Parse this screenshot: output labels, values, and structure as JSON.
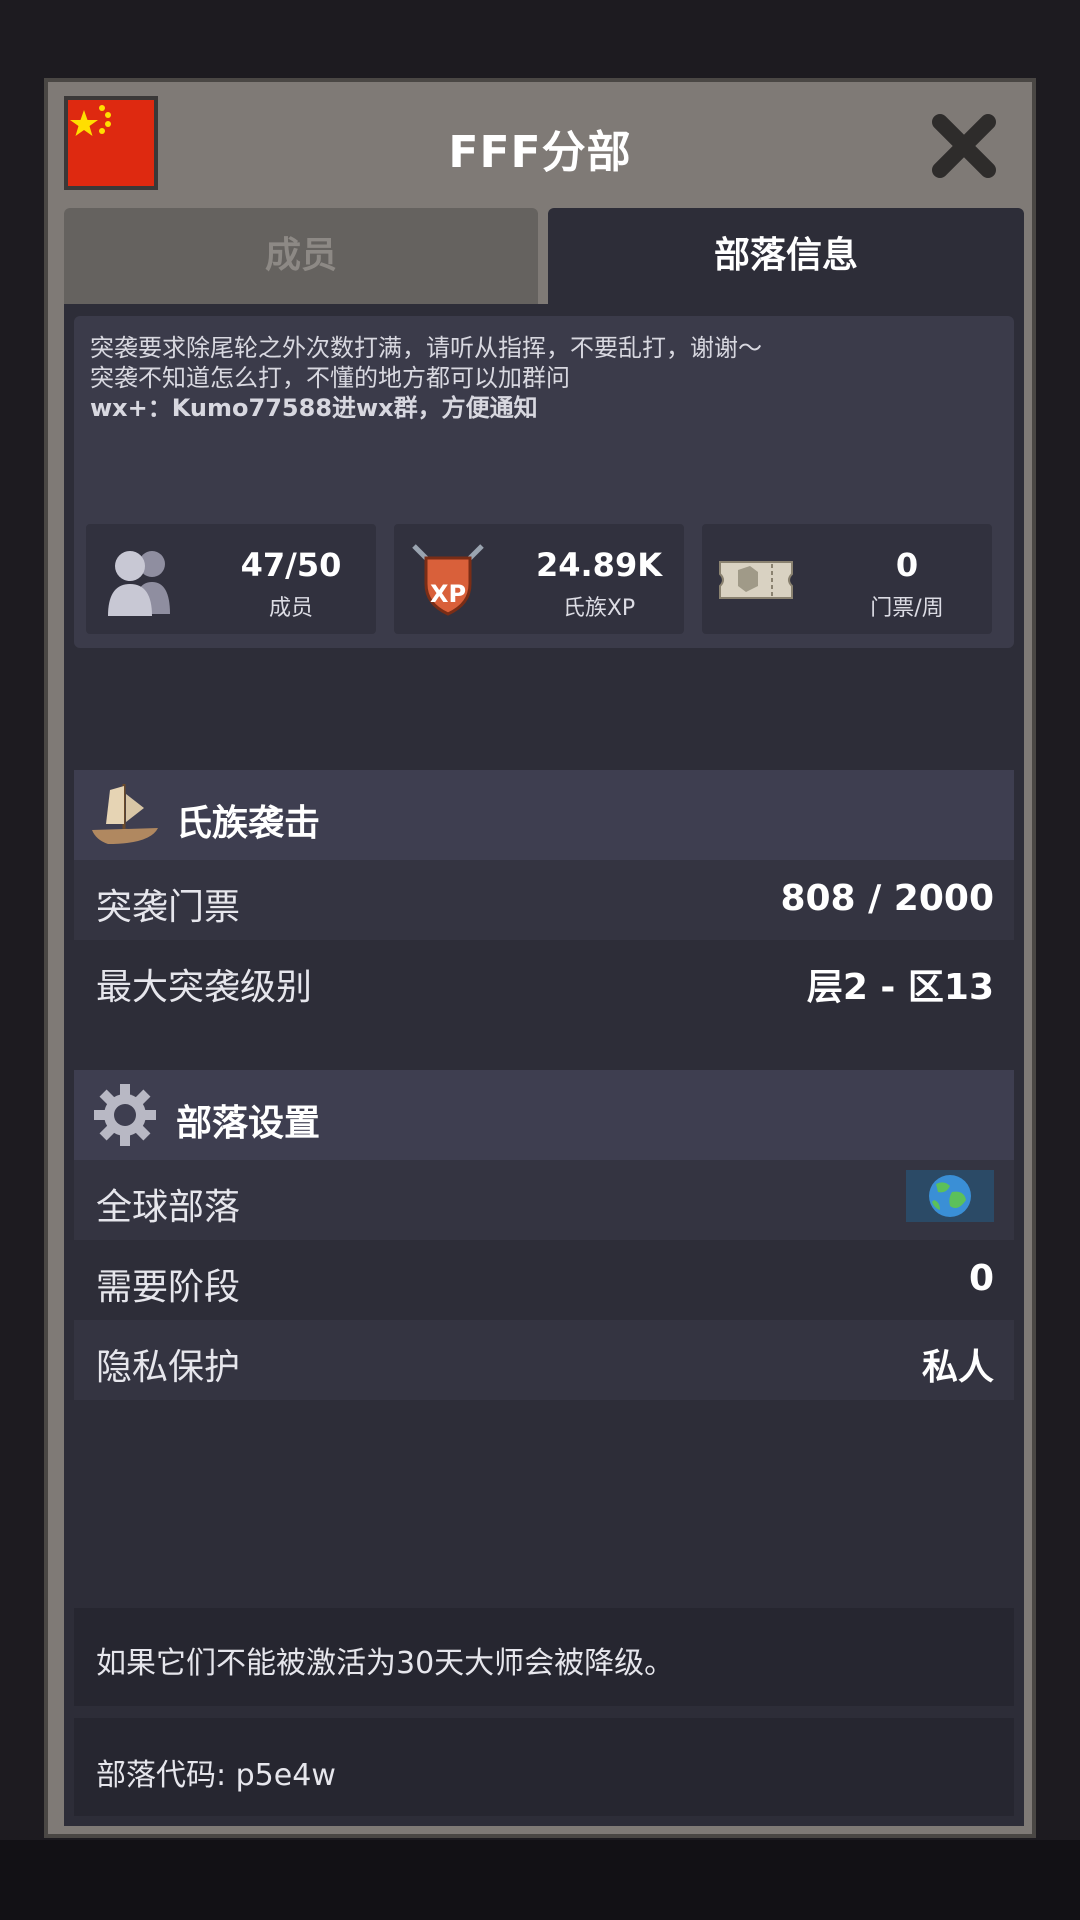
{
  "dialog": {
    "title": "FFF分部",
    "flag_icon": "china-flag-icon",
    "close_icon": "close-icon"
  },
  "tabs": [
    {
      "label": "成员",
      "active": false
    },
    {
      "label": "部落信息",
      "active": true
    }
  ],
  "description": {
    "lines": [
      "突袭要求除尾轮之外次数打满，请听从指挥，不要乱打，谢谢～",
      "突袭不知道怎么打，不懂的地方都可以加群问",
      "wx+：Kumo77588进wx群，方便通知"
    ]
  },
  "stats": [
    {
      "icon": "members-icon",
      "value": "47/50",
      "label": "成员"
    },
    {
      "icon": "clan-xp-shield-icon",
      "value": "24.89K",
      "label": "氏族XP"
    },
    {
      "icon": "ticket-icon",
      "value": "0",
      "label": "门票/周"
    }
  ],
  "clan_raid": {
    "title": "氏族袭击",
    "icon": "ship-icon",
    "rows": [
      {
        "label": "突袭门票",
        "value": "808 / 2000"
      },
      {
        "label": "最大突袭级别",
        "value": "层2 - 区13"
      }
    ]
  },
  "clan_settings": {
    "title": "部落设置",
    "icon": "gear-icon",
    "rows": [
      {
        "label": "全球部落",
        "value_icon": "globe-icon"
      },
      {
        "label": "需要阶段",
        "value": "0"
      },
      {
        "label": "隐私保护",
        "value": "私人"
      }
    ]
  },
  "footer": {
    "notice": "如果它们不能被激活为30天大师会被降级。",
    "code": "部落代码: p5e4w"
  },
  "colors": {
    "panel": "#2d2d38",
    "frame": "#7f7a76",
    "flag_red": "#de2910",
    "flag_yellow": "#ffde00"
  }
}
